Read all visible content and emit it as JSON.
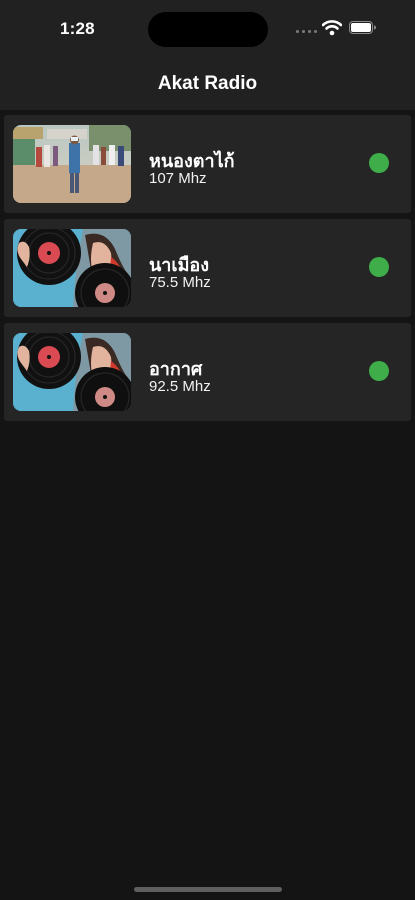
{
  "status_bar": {
    "time": "1:28",
    "icons": [
      "cellular-signal-icon",
      "wifi-icon",
      "battery-icon"
    ]
  },
  "nav": {
    "title": "Akat Radio"
  },
  "stations": [
    {
      "name": "หนองตาไก้",
      "frequency": "107 Mhz",
      "status": "online",
      "image": "outdoor-crowd-photo"
    },
    {
      "name": "นาเมือง",
      "frequency": "75.5 Mhz",
      "status": "online",
      "image": "woman-vinyl-records-photo"
    },
    {
      "name": "อากาศ",
      "frequency": "92.5 Mhz",
      "status": "online",
      "image": "woman-vinyl-records-photo"
    }
  ],
  "colors": {
    "background": "#141414",
    "header": "#212121",
    "row": "#252525",
    "online_indicator": "#3ead4a"
  }
}
